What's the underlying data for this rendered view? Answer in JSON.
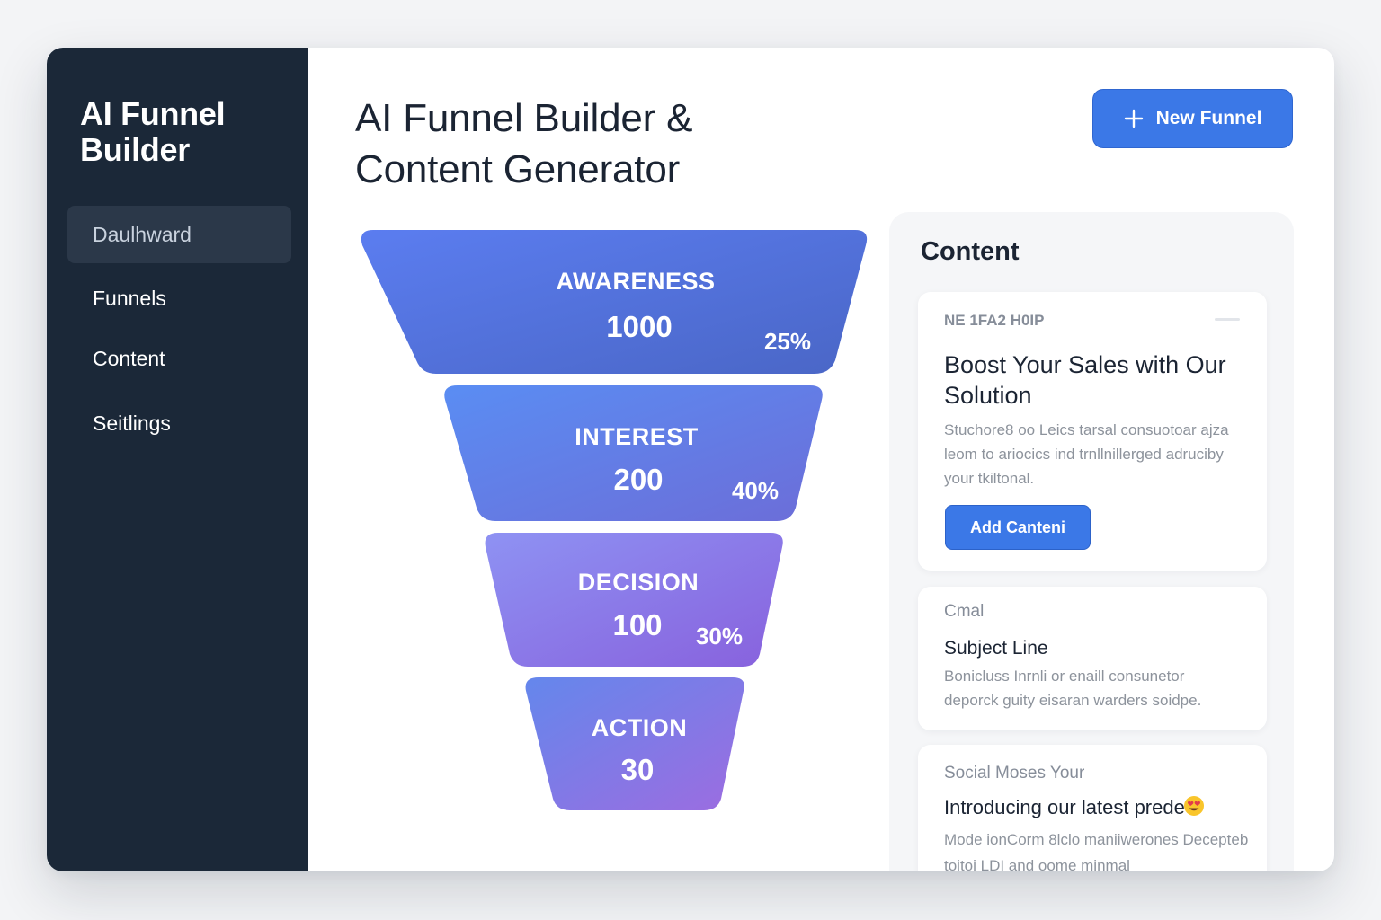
{
  "app": {
    "brand": "AI Funnel Builder"
  },
  "sidebar": {
    "items": [
      {
        "label": "Daulhward",
        "active": true
      },
      {
        "label": "Funnels",
        "active": false
      },
      {
        "label": "Content",
        "active": false
      },
      {
        "label": "Seitlings",
        "active": false
      }
    ]
  },
  "header": {
    "title": "AI Funnel Builder & Content Generator",
    "new_button_label": "New Funnel",
    "new_button_icon": "plus-icon"
  },
  "funnel": {
    "stages": [
      {
        "name": "AWARENESS",
        "value": "1000",
        "percent": "25%",
        "color_start": "#5b7df0",
        "color_end": "#4a6cc9"
      },
      {
        "name": "INTEREST",
        "value": "200",
        "percent": "40%",
        "color_start": "#5c8cf1",
        "color_end": "#6d6fd9"
      },
      {
        "name": "DECISION",
        "value": "100",
        "percent": "30%",
        "color_start": "#8d8ff2",
        "color_end": "#8a64df"
      },
      {
        "name": "ACTION",
        "value": "30",
        "percent": "",
        "color_start": "#6d86ea",
        "color_end": "#9a6ce0"
      }
    ]
  },
  "content": {
    "heading": "Content",
    "cards": [
      {
        "tag": "NE 1FA2 H0IP",
        "title": "Boost Your Sales with Our Solution",
        "body": "Stuchore8 oo Leics tarsal consuotoar ajza leom to ariocics ind trnllnillerged adruciby your tkiltonal.",
        "button": "Add Canteni"
      },
      {
        "tag": "Cmal",
        "subject": "Subject Line",
        "body": "Bonicluss Inrnli or enaill consunetor deporck guity eisaran warders soidpe."
      },
      {
        "tag": "Social Moses Your",
        "title": "Introducing our latest prede",
        "emoji": "heart-eyes-emoji",
        "body": "Mode ionCorm 8lclo maniiwerones Decepteb toitoi LDI and oome minmal"
      }
    ]
  },
  "colors": {
    "sidebar_bg": "#1b2838",
    "accent": "#3b78e7",
    "panel_bg": "#f5f6f8"
  }
}
